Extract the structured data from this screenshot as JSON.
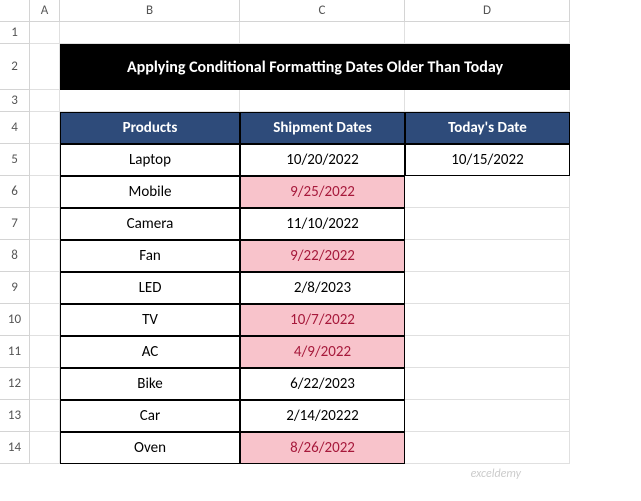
{
  "columns": [
    "A",
    "B",
    "C",
    "D"
  ],
  "rows": [
    "1",
    "2",
    "3",
    "4",
    "5",
    "6",
    "7",
    "8",
    "9",
    "10",
    "11",
    "12",
    "13",
    "14"
  ],
  "title": "Applying Conditional Formatting Dates Older Than Today",
  "headers": {
    "products": "Products",
    "shipment": "Shipment Dates",
    "today": "Today's Date"
  },
  "todays_date": "10/15/2022",
  "data": [
    {
      "product": "Laptop",
      "date": "10/20/2022",
      "highlight": false
    },
    {
      "product": "Mobile",
      "date": "9/25/2022",
      "highlight": true
    },
    {
      "product": "Camera",
      "date": "11/10/2022",
      "highlight": false
    },
    {
      "product": "Fan",
      "date": "9/22/2022",
      "highlight": true
    },
    {
      "product": "LED",
      "date": "2/8/2023",
      "highlight": false
    },
    {
      "product": "TV",
      "date": "10/7/2022",
      "highlight": true
    },
    {
      "product": "AC",
      "date": "4/9/2022",
      "highlight": true
    },
    {
      "product": "Bike",
      "date": "6/22/2023",
      "highlight": false
    },
    {
      "product": "Car",
      "date": "2/14/20222",
      "highlight": false
    },
    {
      "product": "Oven",
      "date": "8/26/2022",
      "highlight": true
    }
  ],
  "watermark": "exceldemy",
  "chart_data": {
    "type": "table",
    "title": "Applying Conditional Formatting Dates Older Than Today",
    "columns": [
      "Products",
      "Shipment Dates",
      "Today's Date"
    ],
    "rows": [
      [
        "Laptop",
        "10/20/2022",
        "10/15/2022"
      ],
      [
        "Mobile",
        "9/25/2022",
        ""
      ],
      [
        "Camera",
        "11/10/2022",
        ""
      ],
      [
        "Fan",
        "9/22/2022",
        ""
      ],
      [
        "LED",
        "2/8/2023",
        ""
      ],
      [
        "TV",
        "10/7/2022",
        ""
      ],
      [
        "AC",
        "4/9/2022",
        ""
      ],
      [
        "Bike",
        "6/22/2023",
        ""
      ],
      [
        "Car",
        "2/14/20222",
        ""
      ],
      [
        "Oven",
        "8/26/2022",
        ""
      ]
    ]
  }
}
